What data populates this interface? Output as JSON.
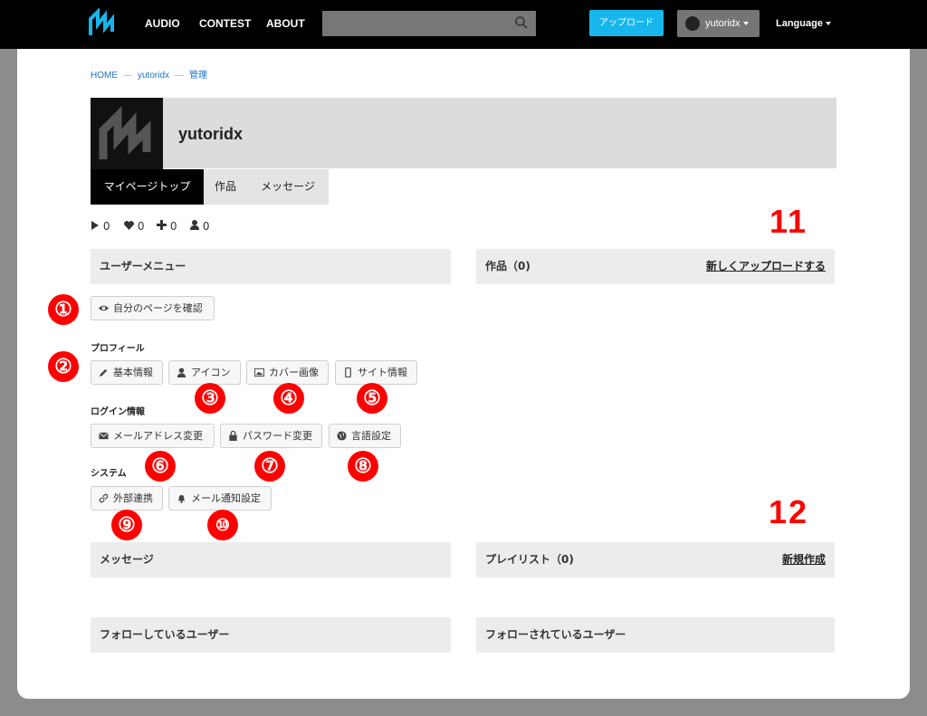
{
  "nav": {
    "links": [
      "AUDIO",
      "CONTEST",
      "ABOUT"
    ],
    "upload": "アップロード",
    "user": "yutoridx",
    "language": "Language"
  },
  "breadcrumb": [
    "HOME",
    "yutoridx",
    "管理"
  ],
  "profile": {
    "name": "yutoridx",
    "tabs": [
      "マイページトップ",
      "作品",
      "メッセージ"
    ]
  },
  "stats": {
    "plays": "0",
    "likes": "0",
    "adds": "0",
    "followers": "0"
  },
  "user_menu": {
    "title": "ユーザーメニュー",
    "view_page": "自分のページを確認",
    "profile_label": "プロフィール",
    "profile_buttons": [
      "基本情報",
      "アイコン",
      "カバー画像",
      "サイト情報"
    ],
    "login_label": "ログイン情報",
    "login_buttons": [
      "メールアドレス変更",
      "パスワード変更",
      "言語設定"
    ],
    "system_label": "システム",
    "system_buttons": [
      "外部連携",
      "メール通知設定"
    ]
  },
  "works": {
    "title": "作品（0)",
    "action": "新しくアップロードする"
  },
  "messages": {
    "title": "メッセージ"
  },
  "playlist": {
    "title": "プレイリスト（0)",
    "action": "新規作成"
  },
  "following": {
    "title": "フォローしているユーザー"
  },
  "followers": {
    "title": "フォローされているユーザー"
  },
  "annotations": [
    "①",
    "②",
    "③",
    "④",
    "⑤",
    "⑥",
    "⑦",
    "⑧",
    "⑨",
    "⑩",
    "11",
    "12"
  ],
  "colors": {
    "accent": "#17b6ec",
    "link": "#1a73c8",
    "annotation": "#ff0000"
  }
}
